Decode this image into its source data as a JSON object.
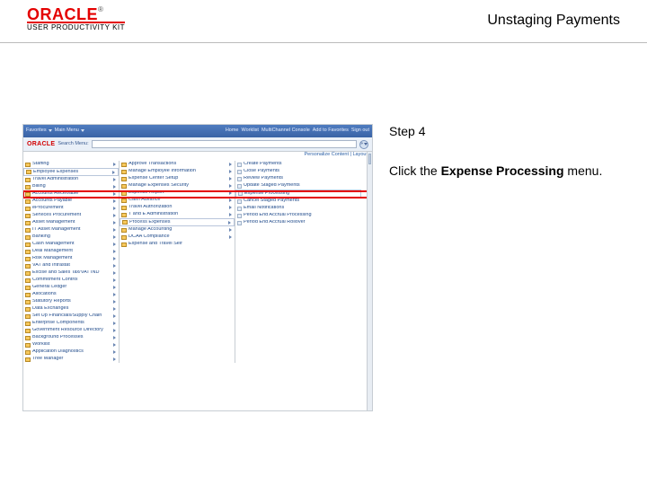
{
  "header": {
    "brand_main": "ORACLE",
    "brand_tm": "®",
    "brand_sub": "USER PRODUCTIVITY KIT",
    "title": "Unstaging Payments"
  },
  "instructions": {
    "step_label": "Step 4",
    "prefix": "Click the ",
    "bold": "Expense Processing",
    "suffix": " menu."
  },
  "app": {
    "topbar": {
      "favorites": "Favorites",
      "main_menu": "Main Menu"
    },
    "nav_right": [
      "Home",
      "Worklist",
      "MultiChannel Console",
      "Add to Favorites",
      "Sign out"
    ],
    "search_label": "Search Menu:",
    "personalize": "Personalize Content | Layout",
    "col1": [
      "Staffing",
      "Employee Expenses",
      "Travel Administration",
      "Billing",
      "Accounts Receivable",
      "Accounts Payable",
      "eProcurement",
      "Services Procurement",
      "Asset Management",
      "IT Asset Management",
      "Banking",
      "Cash Management",
      "Deal Management",
      "Risk Management",
      "VAT and Intrastat",
      "Excise and Sales Tax/VAT IND",
      "Commitment Control",
      "General Ledger",
      "Allocations",
      "Statutory Reports",
      "Data Exchanges",
      "Set Up Financials/Supply Chain",
      "Enterprise Components",
      "Government Resource Directory",
      "Background Processes",
      "Worklist",
      "Application Diagnostics",
      "Tree Manager"
    ],
    "col2": [
      "Approve Transactions",
      "Manage Employee Information",
      "Expense Center Setup",
      "Manage Expenses Security",
      "Expense Report",
      "Cash Advance",
      "Travel Authorization",
      "T and E Administration",
      "Process Expenses",
      "Manage Accounting",
      "DCAA Compliance",
      "Expense and Travel Self"
    ],
    "col3": [
      "Create Payments",
      "Close Payments",
      "Review Payments",
      "Update Staged Payments",
      "Expense Processing",
      "Cancel Staged Payments",
      "Email Notifications",
      "Period End Accrual Processing",
      "Period End Accrual Rollover"
    ]
  }
}
